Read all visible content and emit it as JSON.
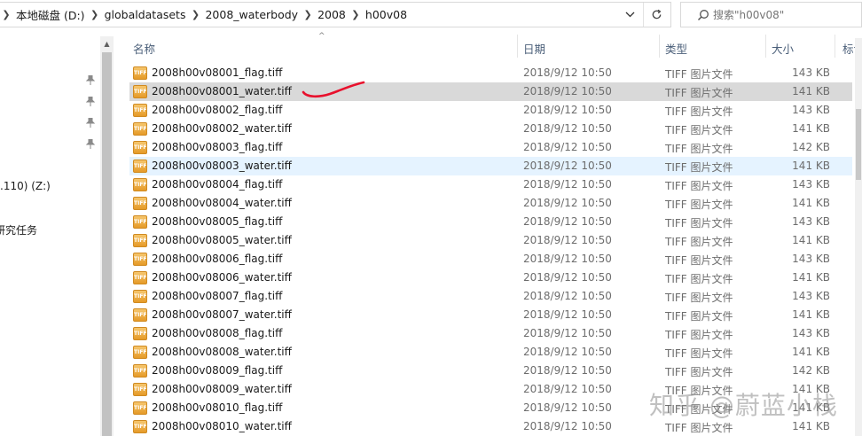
{
  "address": {
    "crumbs": [
      "本地磁盘 (D:)",
      "globaldatasets",
      "2008_waterbody",
      "2008",
      "h00v08"
    ]
  },
  "search": {
    "placeholder": "搜索\"h00v08\""
  },
  "nav": {
    "items": [
      ".110) (Z:)",
      "研究任务"
    ]
  },
  "columns": {
    "name": "名称",
    "date": "日期",
    "type": "类型",
    "size": "大小",
    "tags": "标记"
  },
  "files": [
    {
      "name": "2008h00v08001_flag.tiff",
      "date": "2018/9/12 10:50",
      "type": "TIFF 图片文件",
      "size": "143 KB"
    },
    {
      "name": "2008h00v08001_water.tiff",
      "date": "2018/9/12 10:50",
      "type": "TIFF 图片文件",
      "size": "141 KB"
    },
    {
      "name": "2008h00v08002_flag.tiff",
      "date": "2018/9/12 10:50",
      "type": "TIFF 图片文件",
      "size": "143 KB"
    },
    {
      "name": "2008h00v08002_water.tiff",
      "date": "2018/9/12 10:50",
      "type": "TIFF 图片文件",
      "size": "141 KB"
    },
    {
      "name": "2008h00v08003_flag.tiff",
      "date": "2018/9/12 10:50",
      "type": "TIFF 图片文件",
      "size": "142 KB"
    },
    {
      "name": "2008h00v08003_water.tiff",
      "date": "2018/9/12 10:50",
      "type": "TIFF 图片文件",
      "size": "141 KB"
    },
    {
      "name": "2008h00v08004_flag.tiff",
      "date": "2018/9/12 10:50",
      "type": "TIFF 图片文件",
      "size": "143 KB"
    },
    {
      "name": "2008h00v08004_water.tiff",
      "date": "2018/9/12 10:50",
      "type": "TIFF 图片文件",
      "size": "141 KB"
    },
    {
      "name": "2008h00v08005_flag.tiff",
      "date": "2018/9/12 10:50",
      "type": "TIFF 图片文件",
      "size": "143 KB"
    },
    {
      "name": "2008h00v08005_water.tiff",
      "date": "2018/9/12 10:50",
      "type": "TIFF 图片文件",
      "size": "141 KB"
    },
    {
      "name": "2008h00v08006_flag.tiff",
      "date": "2018/9/12 10:50",
      "type": "TIFF 图片文件",
      "size": "143 KB"
    },
    {
      "name": "2008h00v08006_water.tiff",
      "date": "2018/9/12 10:50",
      "type": "TIFF 图片文件",
      "size": "141 KB"
    },
    {
      "name": "2008h00v08007_flag.tiff",
      "date": "2018/9/12 10:50",
      "type": "TIFF 图片文件",
      "size": "143 KB"
    },
    {
      "name": "2008h00v08007_water.tiff",
      "date": "2018/9/12 10:50",
      "type": "TIFF 图片文件",
      "size": "141 KB"
    },
    {
      "name": "2008h00v08008_flag.tiff",
      "date": "2018/9/12 10:50",
      "type": "TIFF 图片文件",
      "size": "143 KB"
    },
    {
      "name": "2008h00v08008_water.tiff",
      "date": "2018/9/12 10:50",
      "type": "TIFF 图片文件",
      "size": "141 KB"
    },
    {
      "name": "2008h00v08009_flag.tiff",
      "date": "2018/9/12 10:50",
      "type": "TIFF 图片文件",
      "size": "142 KB"
    },
    {
      "name": "2008h00v08009_water.tiff",
      "date": "2018/9/12 10:50",
      "type": "TIFF 图片文件",
      "size": "141 KB"
    },
    {
      "name": "2008h00v08010_flag.tiff",
      "date": "2018/9/12 10:50",
      "type": "TIFF 图片文件",
      "size": "141 KB"
    },
    {
      "name": "2008h00v08010_water.tiff",
      "date": "2018/9/12 10:50",
      "type": "TIFF 图片文件",
      "size": "141 KB"
    }
  ],
  "selected_index": 1,
  "hover_index": 5,
  "file_icon_text": "TIFF",
  "watermark": "知乎 @蔚蓝小栈",
  "colors": {
    "selected_row": "#d9d9d9",
    "hover_row": "#e5f3ff",
    "annotation_stroke": "#e8112d",
    "header_text": "#4c607a"
  },
  "icons": {
    "search": "search-icon",
    "refresh": "refresh-icon",
    "dropdown": "chevron-down-icon",
    "pin": "pin-icon",
    "file": "tiff-file-icon"
  }
}
